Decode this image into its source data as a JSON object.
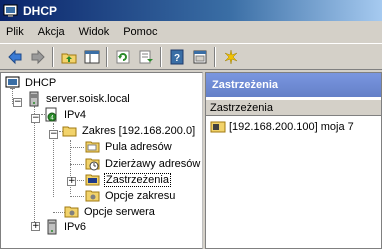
{
  "window": {
    "title": "DHCP",
    "icon": "dhcp-console-icon"
  },
  "menu": {
    "items": [
      {
        "label": "Plik"
      },
      {
        "label": "Akcja"
      },
      {
        "label": "Widok"
      },
      {
        "label": "Pomoc"
      }
    ]
  },
  "toolbar": {
    "buttons": [
      {
        "icon": "back-arrow-icon"
      },
      {
        "icon": "forward-arrow-icon"
      },
      {
        "icon": "up-folder-icon"
      },
      {
        "icon": "show-hide-tree-icon"
      },
      {
        "icon": "refresh-icon"
      },
      {
        "icon": "export-list-icon"
      },
      {
        "icon": "help-icon"
      },
      {
        "icon": "properties-icon"
      },
      {
        "icon": "add-reservation-icon"
      }
    ]
  },
  "tree": {
    "root": "DHCP",
    "server": "server.soisk.local",
    "ipv4": "IPv4",
    "scope": "Zakres [192.168.200.0]",
    "address_pool": "Pula adresów",
    "address_leases": "Dzierżawy adresów",
    "reservations": "Zastrzeżenia",
    "scope_options": "Opcje zakresu",
    "server_options": "Opcje serwera",
    "ipv6": "IPv6",
    "selected": "Zastrzeżenia"
  },
  "details": {
    "title": "Zastrzeżenia",
    "column_header": "Zastrzeżenia",
    "rows": [
      {
        "label": "[192.168.200.100] moja 7"
      }
    ]
  }
}
